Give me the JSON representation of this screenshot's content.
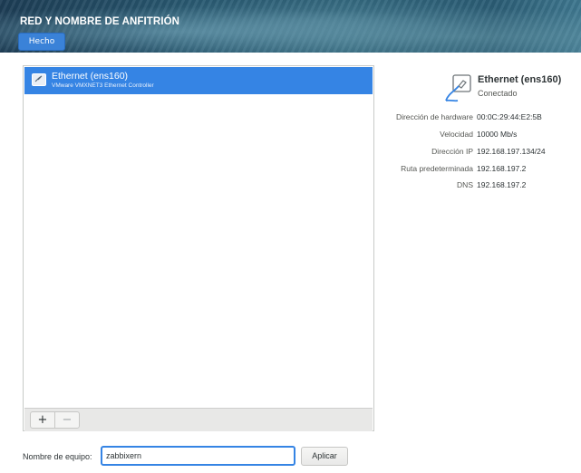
{
  "header": {
    "title": "RED Y NOMBRE DE ANFITRIÓN",
    "done_label": "Hecho"
  },
  "devices": [
    {
      "name": "Ethernet (ens160)",
      "description": "VMware VMXNET3 Ethernet Controller",
      "icon": "ethernet-icon",
      "selected": true
    }
  ],
  "toolbar": {
    "add_label": "+",
    "remove_label": "−"
  },
  "details": {
    "title": "Ethernet (ens160)",
    "status": "Conectado",
    "icon": "network-wired-icon",
    "rows": [
      {
        "label": "Dirección de hardware",
        "value": "00:0C:29:44:E2:5B"
      },
      {
        "label": "Velocidad",
        "value": "10000 Mb/s"
      },
      {
        "label": "Dirección IP",
        "value": "192.168.197.134/24"
      },
      {
        "label": "Ruta predeterminada",
        "value": "192.168.197.2"
      },
      {
        "label": "DNS",
        "value": "192.168.197.2"
      }
    ]
  },
  "hostname": {
    "label": "Nombre de equipo:",
    "value": "zabbixern",
    "apply_label": "Aplicar"
  },
  "colors": {
    "accent": "#3584e4",
    "done_button": "#3a82d8"
  }
}
